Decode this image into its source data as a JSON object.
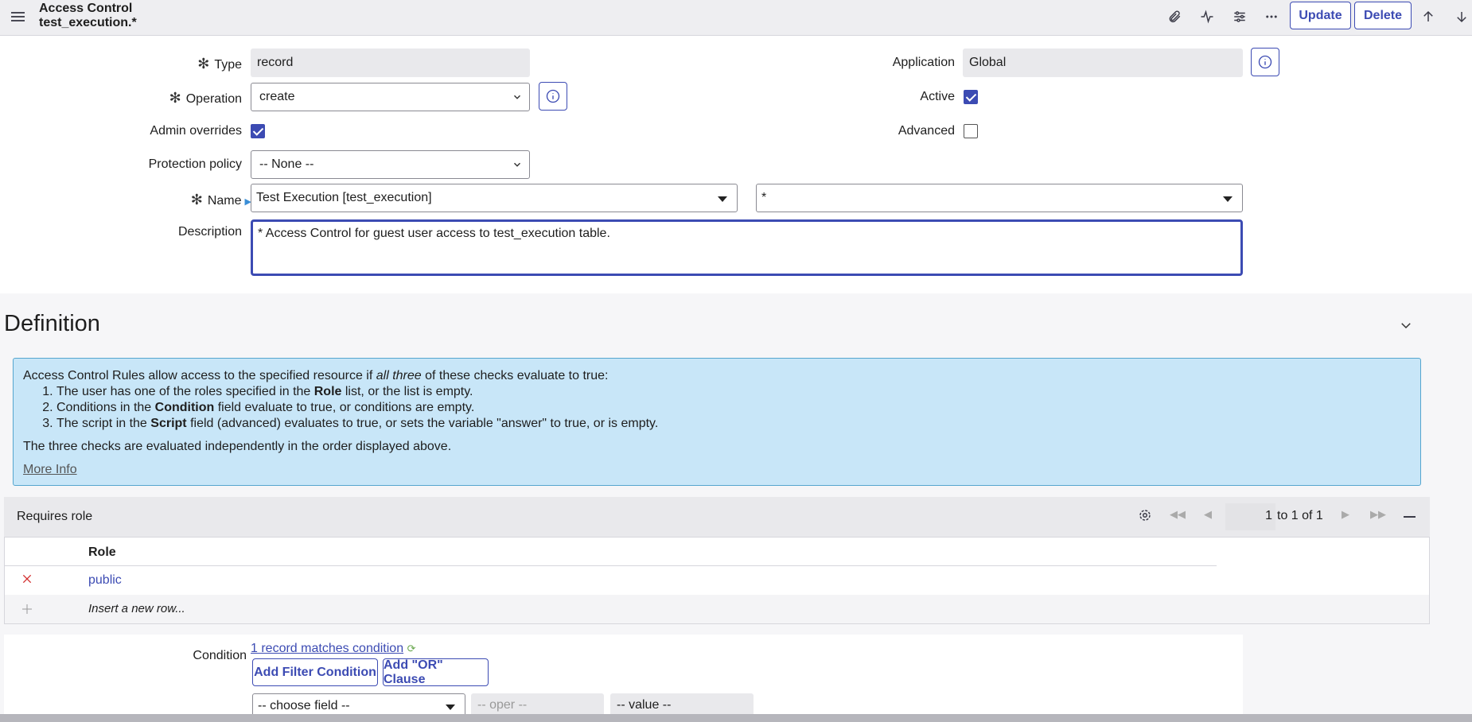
{
  "header": {
    "title": "Access Control",
    "subtitle": "test_execution.*",
    "update_label": "Update",
    "delete_label": "Delete",
    "icons": [
      "menu-icon",
      "paperclip-icon",
      "activity-icon",
      "sliders-icon",
      "more-icon",
      "arrow-up-icon",
      "arrow-down-icon"
    ]
  },
  "form": {
    "type": {
      "label": "Type",
      "value": "record"
    },
    "application": {
      "label": "Application",
      "value": "Global"
    },
    "operation": {
      "label": "Operation",
      "value": "create"
    },
    "active": {
      "label": "Active",
      "checked": true
    },
    "admin_overrides": {
      "label": "Admin overrides",
      "checked": true
    },
    "advanced": {
      "label": "Advanced",
      "checked": false
    },
    "protection_policy": {
      "label": "Protection policy",
      "value": "-- None --"
    },
    "name": {
      "label": "Name",
      "table": "Test Execution [test_execution]",
      "field": "*"
    },
    "description": {
      "label": "Description",
      "value": "* Access Control for guest user access to test_execution table."
    }
  },
  "definition": {
    "title": "Definition",
    "intro_prefix": "Access Control Rules allow access to the specified resource if ",
    "intro_em": "all three",
    "intro_suffix": " of these checks evaluate to true:",
    "items": [
      {
        "pre": "The user has one of the roles specified in the ",
        "bold": "Role",
        "post": " list, or the list is empty."
      },
      {
        "pre": "Conditions in the ",
        "bold": "Condition",
        "post": " field evaluate to true, or conditions are empty."
      },
      {
        "pre": "The script in the ",
        "bold": "Script",
        "post": " field (advanced) evaluates to true, or sets the variable \"answer\" to true, or is empty."
      }
    ],
    "outro": "The three checks are evaluated independently in the order displayed above.",
    "more_info": "More Info",
    "colors": {
      "box": "#c8e6f8",
      "border": "#56a6cf"
    }
  },
  "requires_role": {
    "title": "Requires role",
    "page_number": "1",
    "page_range": "to 1 of 1",
    "column_header": "Role",
    "rows": [
      {
        "role": "public"
      }
    ],
    "insert_label": "Insert a new row..."
  },
  "condition": {
    "label": "Condition",
    "matches": "1 record matches condition",
    "add_filter_label": "Add Filter Condition",
    "add_or_label": "Add \"OR\" Clause",
    "field_placeholder": "-- choose field --",
    "oper_placeholder": "-- oper --",
    "value_placeholder": "-- value --"
  },
  "accent": "#3c4bb3"
}
